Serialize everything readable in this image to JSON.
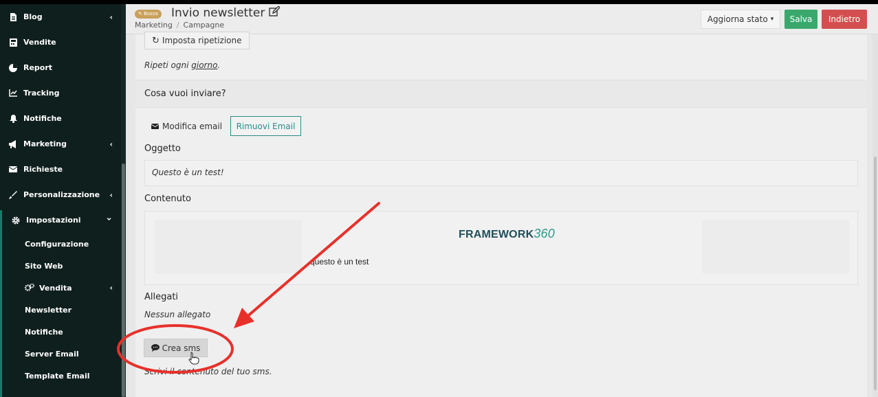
{
  "sidebar": {
    "items": [
      {
        "label": "Blog",
        "icon": "document-icon",
        "chevron": "‹"
      },
      {
        "label": "Vendite",
        "icon": "calculator-icon",
        "chevron": ""
      },
      {
        "label": "Report",
        "icon": "pie-chart-icon",
        "chevron": ""
      },
      {
        "label": "Tracking",
        "icon": "line-chart-icon",
        "chevron": ""
      },
      {
        "label": "Notifiche",
        "icon": "bell-icon",
        "chevron": ""
      },
      {
        "label": "Marketing",
        "icon": "megaphone-icon",
        "chevron": "‹"
      },
      {
        "label": "Richieste",
        "icon": "envelope-icon",
        "chevron": ""
      },
      {
        "label": "Personalizzazione",
        "icon": "brush-icon",
        "chevron": "‹"
      },
      {
        "label": "Impostazioni",
        "icon": "gear-icon",
        "chevron": "⌄"
      }
    ],
    "subitems": [
      {
        "label": "Configurazione"
      },
      {
        "label": "Sito Web"
      },
      {
        "label": "Vendita",
        "icon": "gears-icon",
        "chevron": "‹"
      },
      {
        "label": "Newsletter"
      },
      {
        "label": "Notifiche"
      },
      {
        "label": "Server Email"
      },
      {
        "label": "Template Email"
      }
    ]
  },
  "header": {
    "badge": "Bozza",
    "title": "Invio newsletter",
    "breadcrumb": [
      "Marketing",
      "Campagne"
    ],
    "state_button": "Aggiorna stato",
    "save_button": "Salva",
    "back_button": "Indietro"
  },
  "content": {
    "repeat_button": "Imposta ripetizione",
    "repeat_note_prefix": "Ripeti ogni ",
    "repeat_note_link": "giorno",
    "repeat_note_suffix": ".",
    "section_title": "Cosa vuoi inviare?",
    "edit_email_button": "Modifica email",
    "remove_email_button": "Rimuovi Email",
    "subject_label": "Oggetto",
    "subject_value": "Questo è un test!",
    "content_label": "Contenuto",
    "logo_text": "FRAMEWORK",
    "logo_number": "360",
    "content_body": "questo è un test",
    "attachments_label": "Allegati",
    "attachments_value": "Nessun allegato",
    "sms_button": "Crea sms",
    "sms_note": "Scrivi il contenuto del tuo sms."
  },
  "colors": {
    "sidebar_bg": "#0f1f1d",
    "save": "#3aa86d",
    "back": "#d34f4f",
    "badge": "#c9a15b",
    "teal": "#2a8a8a",
    "annotation": "#e8302a"
  }
}
